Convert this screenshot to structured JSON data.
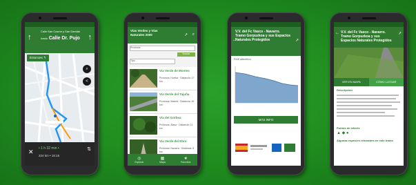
{
  "colors": {
    "accent": "#2e7d32",
    "background": "#1e8a1e"
  },
  "phone1": {
    "street_line1": "Calle San Cosme y San Damián",
    "street_prefix": "hacia",
    "street_name": "Calle Dr. Pujo",
    "chip": "Entonces ↰",
    "eta": "• 1 h 32 min •",
    "distance": "224 km • 16:15"
  },
  "phone2": {
    "title": "Vías Verdes y Vías Naturales 2000",
    "filter1": "Provincia",
    "filter2": "Tipo",
    "search_label": "Buscar",
    "items": [
      {
        "title": "Vía Verde de Montes",
        "desc": "Provincia: Huelva · Distancia: 17 km"
      },
      {
        "title": "Vía Verde del Tajuña",
        "desc": "Provincia: Madrid · Distancia: 49 km"
      },
      {
        "title": "Vía del Gorbea",
        "desc": "Provincia: Álava · Distancia: 12 km"
      },
      {
        "title": "Vía Verde del Ebro",
        "desc": "Provincia: Navarra · Distancia: 8 km"
      }
    ],
    "tabs": [
      {
        "label": "Explorar",
        "icon": "compass-icon"
      },
      {
        "label": "Mapa",
        "icon": "map-icon"
      },
      {
        "label": "Favoritos",
        "icon": "star-icon"
      }
    ]
  },
  "phone3": {
    "title": "V.V. del Fc Vasco - Navarro. Tramo Gorpuzkoa y sus Espacios Naturales Protegidos",
    "chart_label": "Perfil altimétrico",
    "cta": "MÁS INFO"
  },
  "phone4": {
    "title": "V.V. del Fc Vasco - Navarro. Tramo Gorpuzkoa y sus Espacios Naturales Protegidos",
    "btn1": "VER EN MAPA",
    "btn2": "CÓMO LLEGAR",
    "section1": "Descripción",
    "section2": "Puntos de interés",
    "section3": "Algunas especies relevantes en este tramo"
  }
}
